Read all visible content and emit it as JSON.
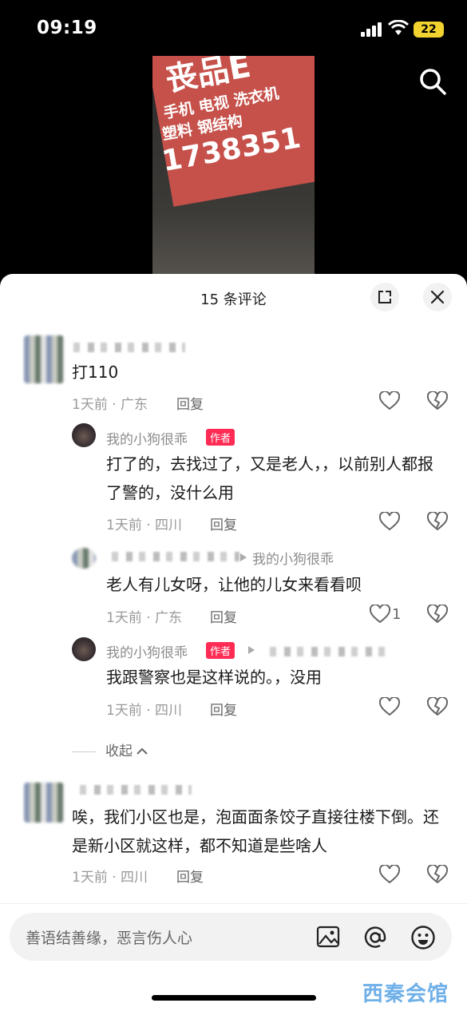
{
  "status_bar": {
    "time": "09:19",
    "battery": "22"
  },
  "video": {
    "sign_line1": "丧品E",
    "sign_line2": "手机 电视 洗衣机",
    "sign_line3": "塑料  钢结构",
    "sign_line4": "1738351"
  },
  "comments_sheet": {
    "title": "15 条评论",
    "comments": [
      {
        "text": "打110",
        "meta": "1天前 · 广东",
        "reply_label": "回复"
      },
      {
        "text": "唉，我们小区也是，泡面面条饺子直接往楼下倒。还是新小区就这样，都不知道是些啥人",
        "meta": "1天前 · 四川",
        "reply_label": "回复"
      }
    ],
    "replies": [
      {
        "name": "我的小狗很乖",
        "badge": "作者",
        "text": "打了的，去找过了，又是老人，，以前别人都报了警的，没什么用",
        "meta": "1天前 · 四川",
        "reply_label": "回复"
      },
      {
        "reply_to": "我的小狗很乖",
        "text": "老人有儿女呀，让他的儿女来看看呗",
        "meta": "1天前 · 广东",
        "reply_label": "回复",
        "like_count": "1"
      },
      {
        "name": "我的小狗很乖",
        "badge": "作者",
        "text": "我跟警察也是这样说的。，没用",
        "meta": "1天前 · 四川",
        "reply_label": "回复"
      }
    ],
    "collapse_label": "收起"
  },
  "input": {
    "placeholder": "善语结善缘，恶言伤人心"
  },
  "watermark": "西秦会馆",
  "colors": {
    "badge": "#fe2c55",
    "battery": "#f2d22e",
    "sign": "#c6504a"
  }
}
